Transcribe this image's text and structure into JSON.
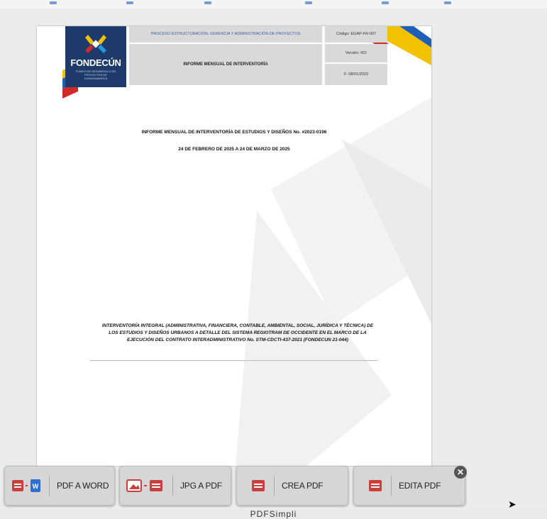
{
  "document": {
    "logo": {
      "name": "FONDECÚN",
      "tagline": "FONDO DE DESARROLLO DE PROYECTOS DE CUNDINAMARCA"
    },
    "header": {
      "process": "PROCESO ESTRUCTURACIÓN, GERENCIA Y ADMINISTRACIÓN DE PROYECTOS",
      "title": "INFORME MENSUAL DE INTERVENTORÍA",
      "code": "Código: EGAP-FR-007",
      "version": "Versión: 001",
      "date": "F: 08/01/2023"
    },
    "report_title": "INFORME MENSUAL DE INTERVENTORÍA DE ESTUDIOS Y DISEÑOS No. #2023-0196",
    "period": "24 DE FEBRERO DE 2025 A 24 DE MARZO DE 2025",
    "project_description": "INTERVENTORÍA INTEGRAL (ADMINISTRATIVA, FINANCIERA, CONTABLE, AMBIENTAL, SOCIAL, JURÍDICA Y TÉCNICA) DE LOS ESTUDIOS Y DISEÑOS URBANOS A DETALLE DEL SISTEMA REGIOTRAM DE OCCIDENTE EN EL MARCO DE LA EJECUCIÓN DEL CONTRATO INTERADMINISTRATIVO No. STM-CDCTI-437-2021 (FONDECUN 21-044)"
  },
  "actions": [
    {
      "label": "PDF A WORD",
      "icon": "pdf-to-word-icon"
    },
    {
      "label": "JPG A PDF",
      "icon": "jpg-to-pdf-icon"
    },
    {
      "label": "CREA PDF",
      "icon": "create-pdf-icon"
    },
    {
      "label": "EDITA PDF",
      "icon": "edit-pdf-icon"
    }
  ],
  "close_symbol": "✕",
  "brand": "PDFSimpli",
  "colors": {
    "pdf_red": "#c9403f",
    "word_blue": "#2f6fd1",
    "navy": "#1d3a6b",
    "stripe_yellow": "#f2c200",
    "stripe_red": "#d12a2a",
    "stripe_blue": "#1f5fb8"
  }
}
